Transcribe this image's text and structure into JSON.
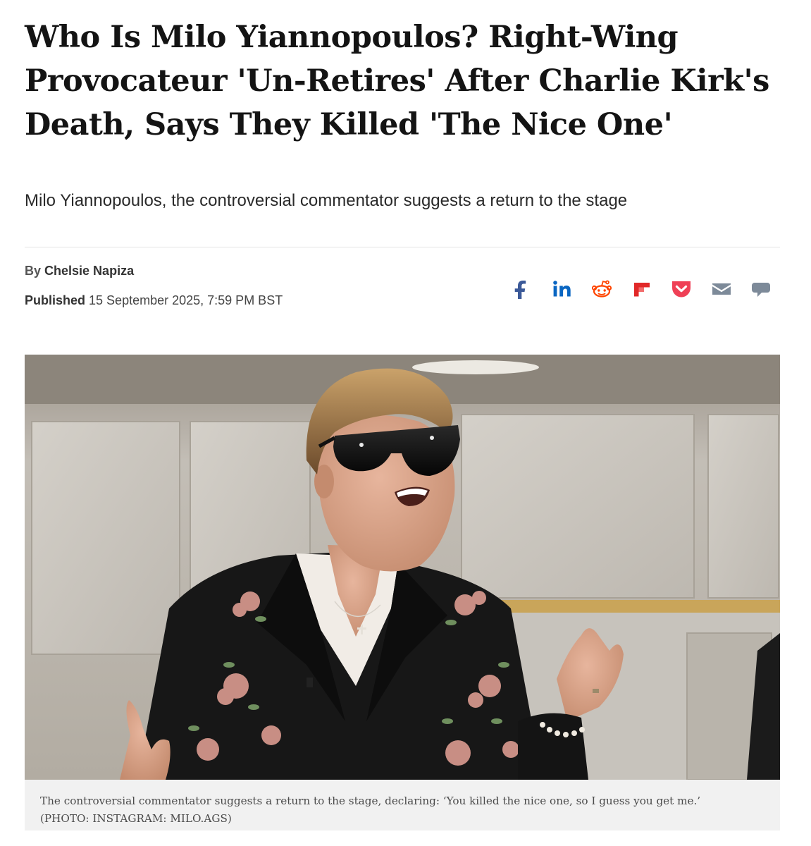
{
  "article": {
    "headline": "Who Is Milo Yiannopoulos? Right-Wing Provocateur 'Un-Retires' After Charlie Kirk's Death, Says They Killed 'The Nice One'",
    "standfirst": "Milo Yiannopoulos, the controversial commentator suggests a return to the stage",
    "byline_prefix": "By",
    "author": "Chelsie Napiza",
    "published_label": "Published",
    "published_date": "15 September 2025, 7:59 PM BST"
  },
  "share": {
    "items": [
      {
        "icon": "facebook-icon",
        "color": "#3b5998"
      },
      {
        "icon": "linkedin-icon",
        "color": "#0a66c2"
      },
      {
        "icon": "reddit-icon",
        "color": "#ff4500"
      },
      {
        "icon": "flipboard-icon",
        "color": "#e12828"
      },
      {
        "icon": "pocket-icon",
        "color": "#ef4056"
      },
      {
        "icon": "email-icon",
        "color": "#7d8a99"
      },
      {
        "icon": "comment-icon",
        "color": "#7d8a99"
      }
    ]
  },
  "image": {
    "caption": "The controversial commentator suggests a return to the stage, declaring: ‘You killed the nice one, so I guess you get me.’",
    "credit": "(PHOTO: INSTAGRAM: MILO.AGS)"
  }
}
